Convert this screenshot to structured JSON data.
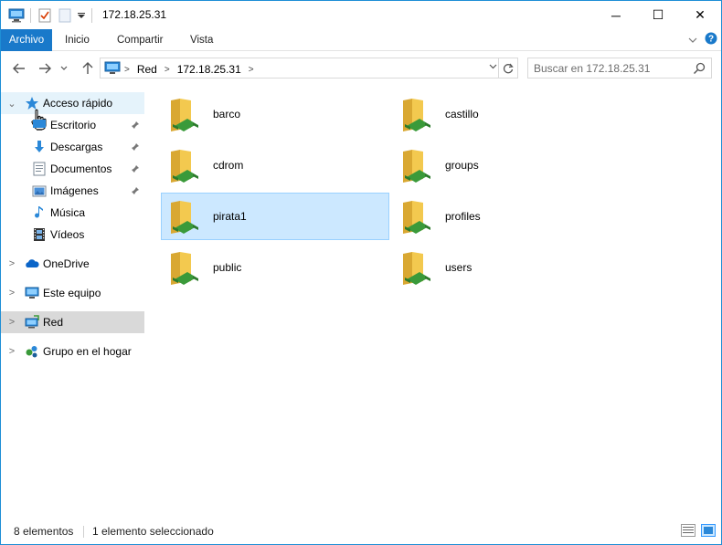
{
  "window": {
    "title": "172.18.25.31",
    "controls": {
      "minimize": "─",
      "maximize": "☐",
      "close": "✕"
    }
  },
  "ribbon": {
    "tabs": [
      "Archivo",
      "Inicio",
      "Compartir",
      "Vista"
    ],
    "accent": "#1979ca"
  },
  "address": {
    "crumbs": [
      "Red",
      "172.18.25.31"
    ],
    "search_placeholder": "Buscar en 172.18.25.31"
  },
  "nav": {
    "quick_access": "Acceso rápido",
    "pinned": [
      "Escritorio",
      "Descargas",
      "Documentos",
      "Imágenes"
    ],
    "unpinned": [
      "Música",
      "Vídeos"
    ],
    "onedrive": "OneDrive",
    "this_pc": "Este equipo",
    "network": "Red",
    "homegroup": "Grupo en el hogar"
  },
  "shares": [
    {
      "name": "barco",
      "icon": "shared-folder-icon"
    },
    {
      "name": "castillo",
      "icon": "shared-folder-icon"
    },
    {
      "name": "cdrom",
      "icon": "shared-folder-icon"
    },
    {
      "name": "groups",
      "icon": "shared-folder-icon"
    },
    {
      "name": "pirata1",
      "icon": "shared-folder-icon",
      "selected": true
    },
    {
      "name": "profiles",
      "icon": "shared-folder-icon"
    },
    {
      "name": "public",
      "icon": "shared-folder-icon"
    },
    {
      "name": "users",
      "icon": "shared-folder-icon"
    }
  ],
  "status": {
    "count": "8 elementos",
    "selection": "1 elemento seleccionado"
  },
  "colors": {
    "selection_bg": "#cce8ff",
    "selection_border": "#99d1ff",
    "nav_selected_bg": "#d9d9d9",
    "folder": "#f3c94f",
    "share_green": "#3a9a3a"
  }
}
